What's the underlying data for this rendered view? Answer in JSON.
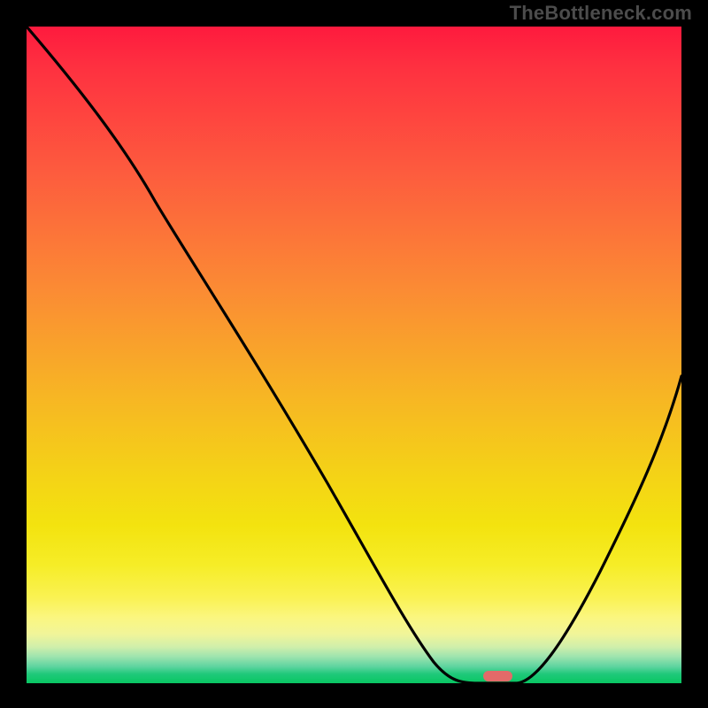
{
  "watermark": "TheBottleneck.com",
  "chart_data": {
    "type": "line",
    "title": "",
    "xlabel": "",
    "ylabel": "",
    "xlim": [
      0,
      100
    ],
    "ylim": [
      0,
      100
    ],
    "grid": false,
    "legend": false,
    "background": "red-yellow-green vertical gradient",
    "x": [
      0,
      8,
      15,
      22,
      30,
      38,
      46,
      54,
      58,
      62,
      65,
      68,
      71,
      75,
      80,
      86,
      92,
      100
    ],
    "y": [
      100,
      90,
      81,
      73,
      62,
      50,
      37,
      23,
      14,
      7,
      3,
      1,
      0,
      0,
      4,
      14,
      27,
      47
    ],
    "series": [
      {
        "name": "bottleneck-curve",
        "stroke": "#000000"
      }
    ],
    "marker": {
      "x": 72,
      "y": 0,
      "color": "#e36a69",
      "shape": "rounded-bar"
    },
    "note": "Values are estimates read from the raster: a V-shaped curve with its minimum near x≈72 touching the bottom, left arm descending from the top-left corner, right arm rising to mid-height at the right edge."
  }
}
